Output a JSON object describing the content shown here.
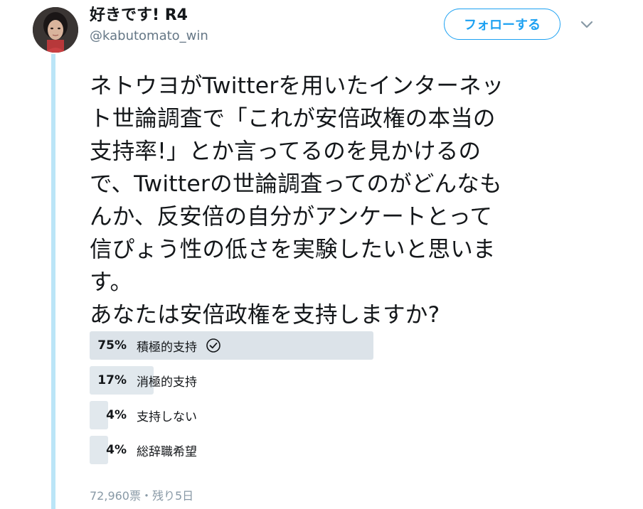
{
  "user": {
    "display_name": "好きです! R4",
    "handle": "@kabutomato_win",
    "avatar": "avatar-photo"
  },
  "actions": {
    "follow_label": "フォローする",
    "menu_icon": "chevron-down-icon"
  },
  "tweet": {
    "lines": [
      "ネトウヨがTwitterを用いたインターネッ",
      "ト世論調査で「これが安倍政権の本当の",
      "支持率!」とか言ってるのを見かけるの",
      "で、Twitterの世論調査ってのがどんなも",
      "んか、反安倍の自分がアンケートとって",
      "信ぴょう性の低さを実験したいと思いま",
      "す。",
      "あなたは安倍政権を支持しますか?"
    ]
  },
  "poll": {
    "options": [
      {
        "percent_label": "75%",
        "label": "積極的支持",
        "fraction": 0.75,
        "winner": true
      },
      {
        "percent_label": "17%",
        "label": "消極的支持",
        "fraction": 0.17,
        "winner": false
      },
      {
        "percent_label": "4%",
        "label": "支持しない",
        "fraction": 0.04,
        "winner": false
      },
      {
        "percent_label": "4%",
        "label": "総辞職希望",
        "fraction": 0.04,
        "winner": false
      }
    ],
    "meta": "72,960票・残り5日",
    "winner_icon": "check-circle-icon"
  },
  "colors": {
    "accent": "#1da1f2",
    "bar": "#e1e8ed",
    "muted_text": "#657786",
    "thread_line": "#bbe5f7"
  }
}
